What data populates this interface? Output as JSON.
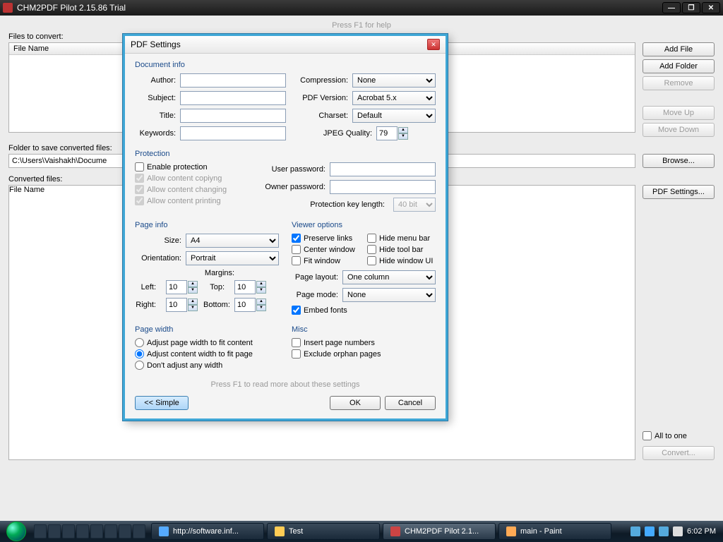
{
  "titlebar": {
    "title": "CHM2PDF Pilot 2.15.86 Trial"
  },
  "main": {
    "help_hint": "Press F1 for help",
    "files_label": "Files to convert:",
    "file_header": "File Name",
    "folder_label": "Folder to save converted files:",
    "folder_path": "C:\\Users\\Vaishakh\\Docume",
    "converted_label": "Converted files:",
    "converted_header": "File Name"
  },
  "buttons": {
    "add_file": "Add File",
    "add_folder": "Add Folder",
    "remove": "Remove",
    "move_up": "Move Up",
    "move_down": "Move Down",
    "browse": "Browse...",
    "pdf_settings": "PDF Settings...",
    "all_to_one": "All to one",
    "convert": "Convert..."
  },
  "dialog": {
    "title": "PDF Settings",
    "doc_info": {
      "group": "Document info",
      "author": "Author:",
      "subject": "Subject:",
      "title": "Title:",
      "keywords": "Keywords:",
      "compression": "Compression:",
      "compression_val": "None",
      "pdf_version": "PDF Version:",
      "pdf_version_val": "Acrobat 5.x",
      "charset": "Charset:",
      "charset_val": "Default",
      "jpeg_q": "JPEG Quality:",
      "jpeg_q_val": "79"
    },
    "protection": {
      "group": "Protection",
      "enable": "Enable protection",
      "copy": "Allow content copiyng",
      "change": "Allow content changing",
      "print": "Allow content printing",
      "user_pw": "User password:",
      "owner_pw": "Owner password:",
      "key_len": "Protection key length:",
      "key_len_val": "40 bit"
    },
    "page_info": {
      "group": "Page info",
      "size": "Size:",
      "size_val": "A4",
      "orient": "Orientation:",
      "orient_val": "Portrait",
      "margins": "Margins:",
      "left": "Left:",
      "left_val": "10",
      "top": "Top:",
      "top_val": "10",
      "right": "Right:",
      "right_val": "10",
      "bottom": "Bottom:",
      "bottom_val": "10"
    },
    "viewer": {
      "group": "Viewer options",
      "preserve": "Preserve links",
      "hide_menu": "Hide menu bar",
      "center": "Center window",
      "hide_tool": "Hide tool bar",
      "fit": "Fit window",
      "hide_ui": "Hide window UI",
      "layout": "Page layout:",
      "layout_val": "One column",
      "mode": "Page mode:",
      "mode_val": "None",
      "embed": "Embed fonts"
    },
    "page_width": {
      "group": "Page width",
      "opt1": "Adjust page width to fit content",
      "opt2": "Adjust content width to fit page",
      "opt3": "Don't adjust any width"
    },
    "misc": {
      "group": "Misc",
      "insert_pn": "Insert page numbers",
      "exclude": "Exclude orphan pages"
    },
    "hint": "Press F1 to read more about these settings",
    "simple": "<< Simple",
    "ok": "OK",
    "cancel": "Cancel"
  },
  "taskbar": {
    "items": [
      {
        "label": "http://software.inf..."
      },
      {
        "label": "Test"
      },
      {
        "label": "CHM2PDF Pilot 2.1..."
      },
      {
        "label": "main - Paint"
      }
    ],
    "clock": "6:02 PM"
  }
}
